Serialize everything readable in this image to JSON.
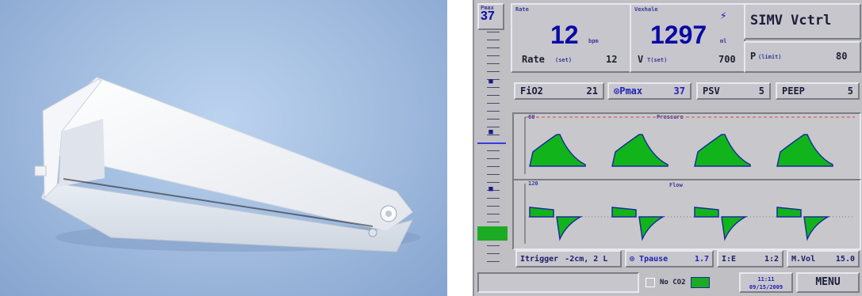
{
  "photo": {
    "alt": "white plastic flow sensor"
  },
  "ventilator": {
    "pmax": {
      "label": "Pmax",
      "value": "37"
    },
    "rate_box": {
      "header": "Rate",
      "value": "12",
      "unit": "bpm",
      "sub_label": "Rate",
      "sub_qual": "(set)",
      "sub_value": "12"
    },
    "volume_box": {
      "header": "Vexhale",
      "value": "1297",
      "unit": "ml",
      "sub_label": "V",
      "sub_qual": "T(set)",
      "sub_value": "700"
    },
    "mode_box": {
      "title": "SIMV Vctrl",
      "sub_label": "P",
      "sub_qual": "(limit)",
      "sub_value": "80"
    },
    "settings": [
      {
        "name": "fio2",
        "label": "FiO2",
        "value": "21"
      },
      {
        "name": "pmax",
        "label": "Pmax",
        "value": "37"
      },
      {
        "name": "psv",
        "label": "PSV",
        "value": "5"
      },
      {
        "name": "peep",
        "label": "PEEP",
        "value": "5"
      }
    ],
    "wave_pressure": {
      "title": "Pressure",
      "scale_top": "60"
    },
    "wave_flow": {
      "title": "Flow",
      "scale_top": "120"
    },
    "bottom": {
      "trigger_label": "Itrigger",
      "trigger_value": "-2cm, 2 L",
      "tpause_label": "Tpause",
      "tpause_value": "1.7",
      "ie_label": "I:E",
      "ie_value": "1:2",
      "mvol_label": "M.Vol",
      "mvol_value": "15.0"
    },
    "footer": {
      "no_co2_label": "No CO2",
      "date_line1": "11:11",
      "date_line2": "09/15/2009",
      "menu_label": "MENU"
    },
    "colors": {
      "wave_fill": "#12b41c",
      "wave_line": "#1a2c9a",
      "bar_cyan": "#4fd8e8",
      "bar_green": "#1cab24",
      "dashed_red": "#d84848"
    }
  }
}
